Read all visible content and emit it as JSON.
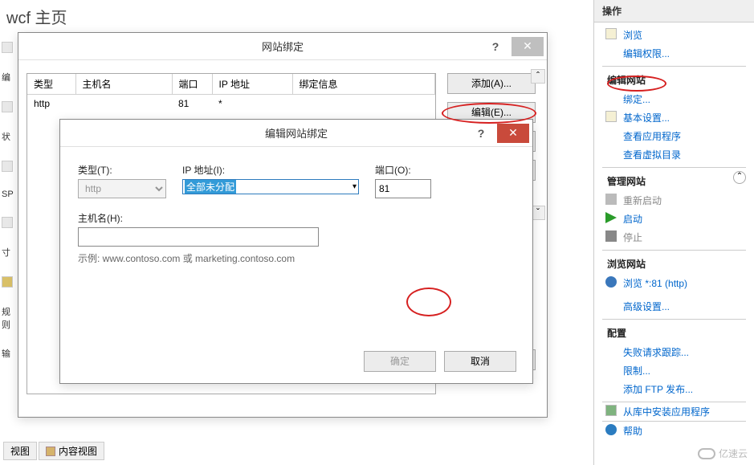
{
  "page": {
    "title": "wcf 主页"
  },
  "left_gutter": {
    "labels": [
      "编",
      "状",
      "SP",
      "寸",
      "规则",
      "输"
    ]
  },
  "bindings_dialog": {
    "title": "网站绑定",
    "help": "?",
    "close": "✕",
    "columns": [
      "类型",
      "主机名",
      "端口",
      "IP 地址",
      "绑定信息"
    ],
    "rows": [
      {
        "type": "http",
        "host": "",
        "port": "81",
        "ip": "*",
        "info": ""
      }
    ],
    "buttons": {
      "add": "添加(A)...",
      "edit": "编辑(E)..."
    }
  },
  "edit_dialog": {
    "title": "编辑网站绑定",
    "help": "?",
    "close": "✕",
    "type_label": "类型(T):",
    "ip_label": "IP 地址(I):",
    "port_label": "端口(O):",
    "host_label": "主机名(H):",
    "type_value": "http",
    "ip_value": "全部未分配",
    "port_value": "81",
    "host_value": "",
    "example": "示例: www.contoso.com 或 marketing.contoso.com",
    "ok": "确定",
    "cancel": "取消"
  },
  "actions": {
    "header": "操作",
    "browse": "浏览",
    "edit_perm": "编辑权限...",
    "sec_edit_site": "编辑网站",
    "bindings": "绑定...",
    "basic": "基本设置...",
    "view_apps": "查看应用程序",
    "view_vdirs": "查看虚拟目录",
    "sec_manage_site": "管理网站",
    "restart": "重新启动",
    "start": "启动",
    "stop": "停止",
    "sec_browse_site": "浏览网站",
    "browse_81": "浏览 *:81 (http)",
    "adv": "高级设置...",
    "sec_config": "配置",
    "failed_req": "失败请求跟踪...",
    "limits": "限制...",
    "add_ftp": "添加 FTP 发布...",
    "install_gallery": "从库中安装应用程序",
    "help": "帮助",
    "chevron": "⌃"
  },
  "tabs": {
    "features": "视图",
    "content": "内容视图"
  },
  "watermark": "亿速云"
}
